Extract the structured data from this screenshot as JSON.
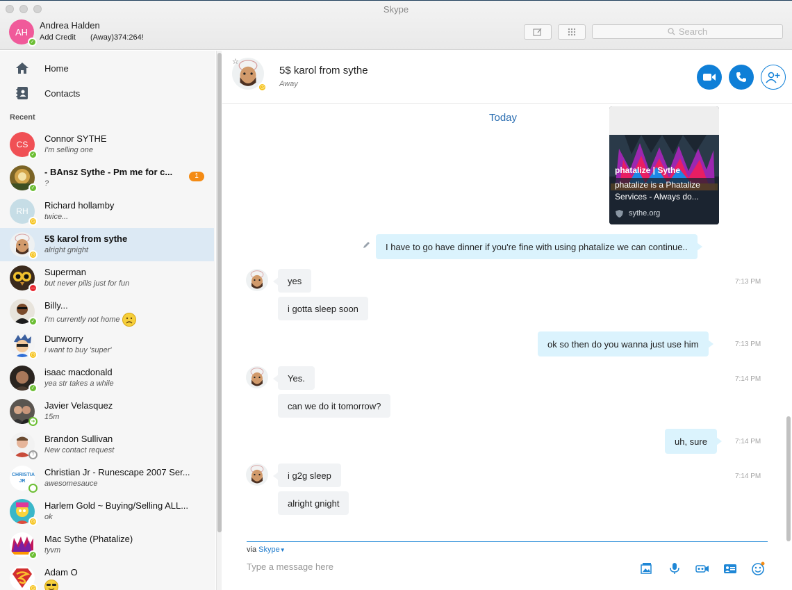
{
  "window": {
    "title": "Skype"
  },
  "profile": {
    "initials": "AH",
    "name": "Andrea Halden",
    "credit_link": "Add Credit",
    "mood": "(Away)374:264!",
    "avatar_color": "#f05a9a"
  },
  "toolbar": {
    "search_placeholder": "Search"
  },
  "sidebar": {
    "nav": [
      {
        "label": "Home",
        "icon": "home-icon"
      },
      {
        "label": "Contacts",
        "icon": "contacts-icon"
      }
    ],
    "recent_label": "Recent",
    "contacts": [
      {
        "name": "Connor SYTHE",
        "mood": "I'm selling one",
        "status": "online",
        "initials": "CS",
        "avatar_color": "#f05055"
      },
      {
        "name": "- BAnsz Sythe - Pm me for c...",
        "mood": "?",
        "status": "online",
        "unread": "1",
        "bold": true
      },
      {
        "name": "Richard hollamby",
        "mood": "twice...",
        "status": "away",
        "initials": "RH",
        "avatar_color": "#c6dde6"
      },
      {
        "name": "5$ karol from sythe",
        "mood": "alright gnight",
        "status": "away",
        "bold": true,
        "active": true
      },
      {
        "name": "Superman",
        "mood": "but never pills just for fun",
        "status": "dnd"
      },
      {
        "name": "Billy...",
        "mood": "I'm currently not home",
        "status": "online",
        "emoji": "sad-emoji"
      },
      {
        "name": "Dunworry",
        "mood": "i want to buy 'super'",
        "status": "away"
      },
      {
        "name": "isaac macdonald",
        "mood": "yea str takes a while",
        "status": "online"
      },
      {
        "name": "Javier Velasquez",
        "mood": "15m",
        "status": "forwarding"
      },
      {
        "name": "Brandon Sullivan",
        "mood": "New contact request",
        "status": "unknown"
      },
      {
        "name": "Christian Jr - Runescape 2007 Ser...",
        "mood": "awesomesauce",
        "status": "offline",
        "avatar_text": "CHRISTIAN JR"
      },
      {
        "name": "Harlem Gold ~ Buying/Selling ALL...",
        "mood": "ok",
        "status": "away"
      },
      {
        "name": "Mac Sythe (Phatalize)",
        "mood": "tyvm",
        "status": "online"
      },
      {
        "name": "Adam O",
        "mood": "",
        "status": "away",
        "emoji": "cool-emoji"
      }
    ]
  },
  "chat": {
    "contact_name": "5$ karol from sythe",
    "contact_status": "Away",
    "day_label": "Today",
    "link_preview": {
      "title": "phatalize | Sythe",
      "description_line1": "phatalize is a Phatalize",
      "description_line2": "Services - Always do...",
      "site": "sythe.org"
    },
    "messages": [
      {
        "from": "me",
        "text": "I have to go have dinner if you're fine with using phatalize we can continue..",
        "time": ""
      },
      {
        "from": "them",
        "text": "yes",
        "time": "7:13 PM"
      },
      {
        "from": "them",
        "text": "i gotta sleep soon",
        "time": ""
      },
      {
        "from": "me",
        "text": "ok so then do you wanna just use him",
        "time": "7:13 PM"
      },
      {
        "from": "them",
        "text": "Yes.",
        "time": "7:14 PM"
      },
      {
        "from": "them",
        "text": "can we do it tomorrow?",
        "time": ""
      },
      {
        "from": "me",
        "text": "uh, sure",
        "time": "7:14 PM"
      },
      {
        "from": "them",
        "text": "i g2g sleep",
        "time": "7:14 PM"
      },
      {
        "from": "them",
        "text": "alright gnight",
        "time": ""
      }
    ],
    "compose": {
      "via_label": "via",
      "via_service": "Skype",
      "placeholder": "Type a message here"
    }
  },
  "colors": {
    "accent": "#0f7fd7",
    "active_row": "#dce9f4",
    "incoming": "#f1f3f5",
    "outgoing": "#dbf3fd"
  }
}
